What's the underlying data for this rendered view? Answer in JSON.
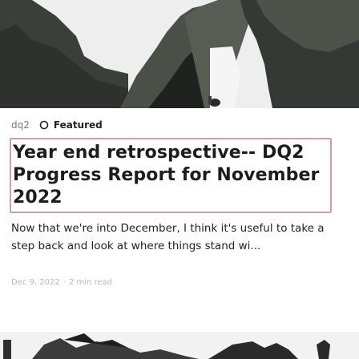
{
  "post": {
    "author_tag": "dq2",
    "featured_label": "Featured",
    "title": "Year end retrospective-- DQ2 Progress Report for November 2022",
    "excerpt": "Now that we're into December, I think it's useful to take a step back and look at where things stand wi...",
    "date": "Dec 9, 2022",
    "separator": "·",
    "read_time": "2 min read"
  },
  "icons": {
    "featured": "star-outline-icon"
  },
  "colors": {
    "title_outline": "#caa3a0",
    "text": "#1d1d1d",
    "muted": "#7a7a7a",
    "faint": "#b8b8b8"
  }
}
